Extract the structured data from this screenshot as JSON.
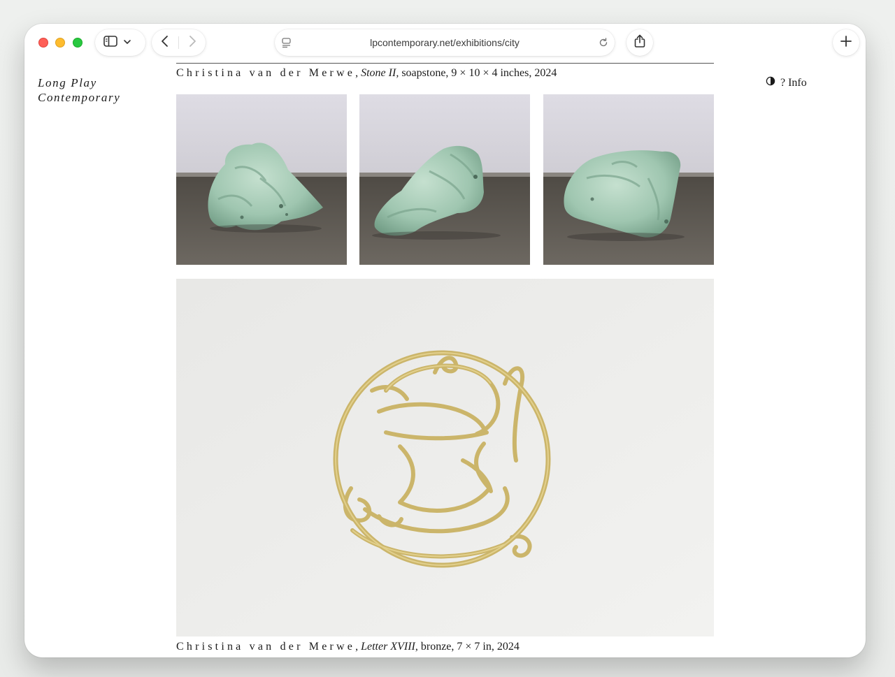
{
  "browser": {
    "url": "lpcontemporary.net/exhibitions/city"
  },
  "site": {
    "title_line1": "Long Play",
    "title_line2": "Contemporary",
    "info_label": "? Info"
  },
  "works": [
    {
      "artist": "Christina van der Merwe",
      "separator": ", ",
      "title": "Stone II,",
      "details": " soapstone, 9 × 10 × 4 inches, 2024"
    },
    {
      "artist": "Christina van der Merwe",
      "separator": ", ",
      "title": "Letter XVIII",
      "details": ", bronze, 7 × 7 in, 2024"
    }
  ],
  "colors": {
    "stone": "#a8cbb7",
    "bronze": "#c9b46a",
    "floor": "#5e5a54",
    "wall": "#e3e1e6"
  }
}
